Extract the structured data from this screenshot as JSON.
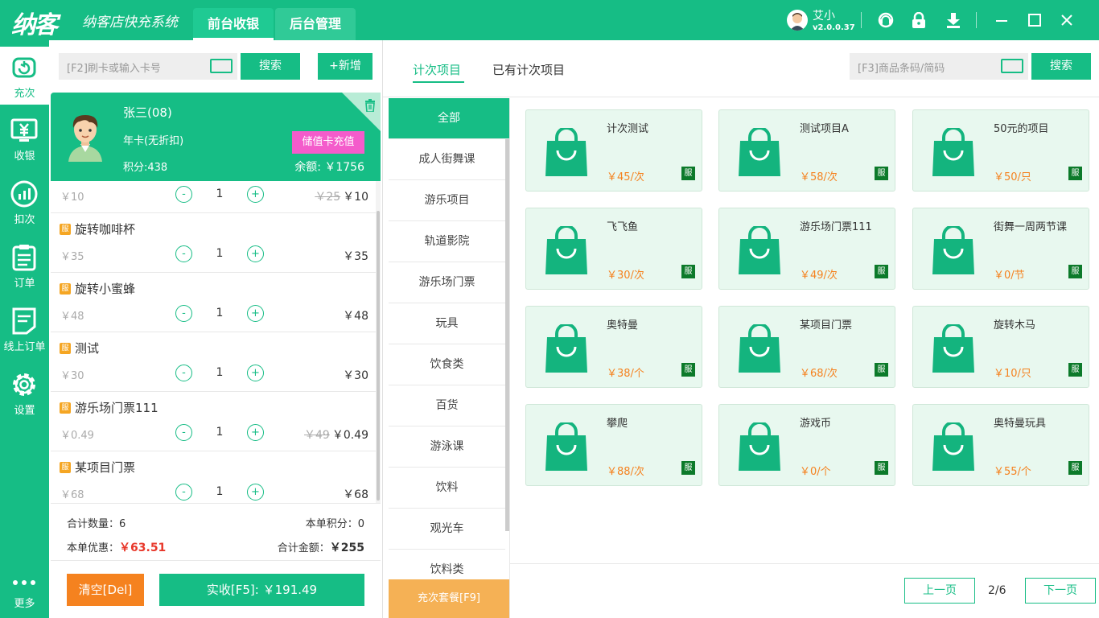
{
  "app": {
    "logo": "纳客",
    "slogan": "纳客店快充系统",
    "tabs": [
      "前台收银",
      "后台管理"
    ],
    "user": {
      "name": "艾小",
      "version": "v2.0.0.37"
    }
  },
  "sidebar": {
    "items": [
      {
        "label": "充次",
        "icon": "recharge-icon"
      },
      {
        "label": "收银",
        "icon": "cashier-icon"
      },
      {
        "label": "扣次",
        "icon": "deduct-icon"
      },
      {
        "label": "订单",
        "icon": "order-icon"
      },
      {
        "label": "线上订单",
        "icon": "online-order-icon"
      },
      {
        "label": "设置",
        "icon": "settings-icon"
      },
      {
        "label": "更多",
        "icon": "more-icon"
      }
    ]
  },
  "left": {
    "search_placeholder": "[F2]刷卡或输入卡号",
    "search_button": "搜索",
    "new_button": "+新增",
    "member": {
      "name": "张三(08)",
      "card_type": "年卡(无折扣)",
      "points": "积分:438",
      "recharge_button": "储值卡充值",
      "balance": "余额: ￥1756"
    },
    "cart_partial": {
      "price": "￥10",
      "qty": "1",
      "old_total": "￥25",
      "total": "￥10"
    },
    "cart": [
      {
        "tag": "服",
        "name": "旋转咖啡杯",
        "price": "￥35",
        "qty": "1",
        "old_total": "",
        "total": "￥35"
      },
      {
        "tag": "服",
        "name": "旋转小蜜蜂",
        "price": "￥48",
        "qty": "1",
        "old_total": "",
        "total": "￥48"
      },
      {
        "tag": "服",
        "name": "测试",
        "price": "￥30",
        "qty": "1",
        "old_total": "",
        "total": "￥30"
      },
      {
        "tag": "服",
        "name": "游乐场门票111",
        "price": "￥0.49",
        "qty": "1",
        "old_total": "￥49",
        "total": "￥0.49"
      },
      {
        "tag": "服",
        "name": "某项目门票",
        "price": "￥68",
        "qty": "1",
        "old_total": "",
        "total": "￥68"
      }
    ],
    "summary": {
      "count_label": "合计数量：",
      "count": "6",
      "points_label": "本单积分：",
      "points": "0",
      "discount_label": "本单优惠：",
      "discount": "￥63.51",
      "amount_label": "合计金额：",
      "amount": "￥255"
    },
    "clear_button": "清空[Del]",
    "pay_button": "实收[F5]: ￥191.49"
  },
  "right": {
    "tabs": [
      "计次项目",
      "已有计次项目"
    ],
    "search_placeholder": "[F3]商品条码/简码",
    "search_button": "搜索",
    "categories": [
      "全部",
      "成人街舞课",
      "游乐项目",
      "轨道影院",
      "游乐场门票",
      "玩具",
      "饮食类",
      "百货",
      "游泳课",
      "饮料",
      "观光车",
      "饮料类"
    ],
    "package_button": "充次套餐[F9]",
    "products": [
      {
        "name": "计次测试",
        "price": "￥45/次",
        "tag": "服"
      },
      {
        "name": "测试项目A",
        "price": "￥58/次",
        "tag": "服"
      },
      {
        "name": "50元的项目",
        "price": "￥50/只",
        "tag": "服"
      },
      {
        "name": "飞飞鱼",
        "price": "￥30/次",
        "tag": "服"
      },
      {
        "name": "游乐场门票111",
        "price": "￥49/次",
        "tag": "服"
      },
      {
        "name": "街舞一周两节课",
        "price": "￥0/节",
        "tag": "服"
      },
      {
        "name": "奥特曼",
        "price": "￥38/个",
        "tag": "服"
      },
      {
        "name": "某项目门票",
        "price": "￥68/次",
        "tag": "服"
      },
      {
        "name": "旋转木马",
        "price": "￥10/只",
        "tag": "服"
      },
      {
        "name": "攀爬",
        "price": "￥88/次",
        "tag": "服"
      },
      {
        "name": "游戏币",
        "price": "￥0/个",
        "tag": "服"
      },
      {
        "name": "奥特曼玩具",
        "price": "￥55/个",
        "tag": "服"
      }
    ],
    "pager": {
      "prev": "上一页",
      "info": "2/6",
      "next": "下一页"
    }
  },
  "colors": {
    "primary": "#16bd85",
    "orange": "#f5821f",
    "pink": "#f45ccb",
    "red": "#e8372a"
  }
}
